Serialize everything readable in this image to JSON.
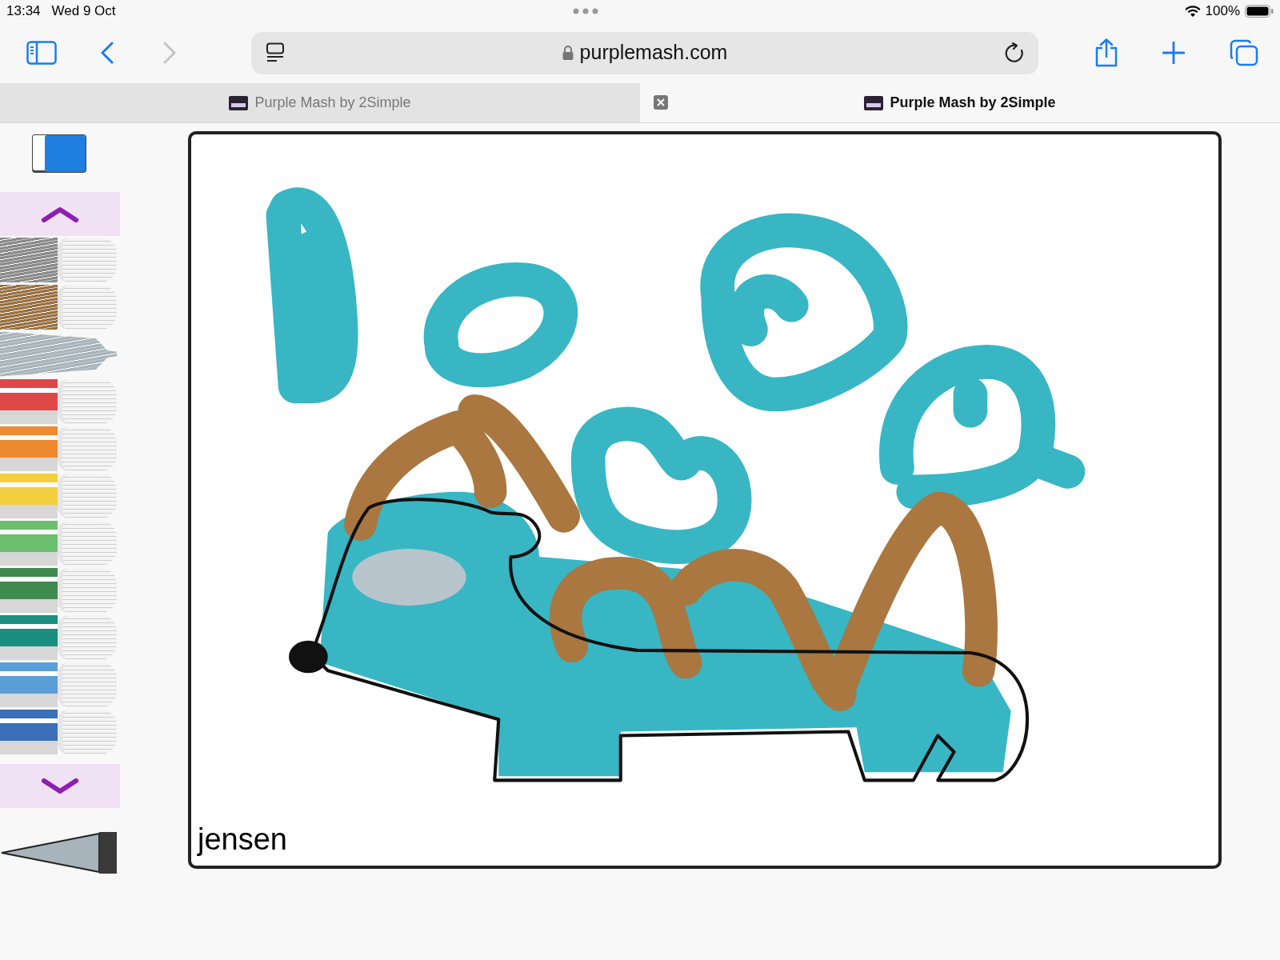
{
  "status_bar": {
    "time": "13:34",
    "date": "Wed 9 Oct",
    "battery": "100%"
  },
  "address_bar": {
    "url": "purplemash.com"
  },
  "tabs": [
    {
      "title": "Purple Mash by 2Simple",
      "selected": false
    },
    {
      "title": "Purple Mash by 2Simple",
      "selected": true
    }
  ],
  "pens": [
    {
      "kind": "texture",
      "color": "#8a8a8a",
      "selected": false
    },
    {
      "kind": "texture",
      "color": "#9a6f3e",
      "selected": false
    },
    {
      "kind": "texture",
      "color": "#a8b4bc",
      "selected": true
    },
    {
      "kind": "color",
      "color": "#e04848",
      "selected": false
    },
    {
      "kind": "color",
      "color": "#ee8a30",
      "selected": false
    },
    {
      "kind": "color",
      "color": "#f2cf3e",
      "selected": false
    },
    {
      "kind": "color",
      "color": "#6cbf6c",
      "selected": false
    },
    {
      "kind": "color",
      "color": "#3f8a4f",
      "selected": false
    },
    {
      "kind": "color",
      "color": "#1a8f80",
      "selected": false
    },
    {
      "kind": "color",
      "color": "#5a9ed8",
      "selected": false
    },
    {
      "kind": "color",
      "color": "#3b6fb8",
      "selected": false
    }
  ],
  "canvas": {
    "caption": "jensen"
  }
}
